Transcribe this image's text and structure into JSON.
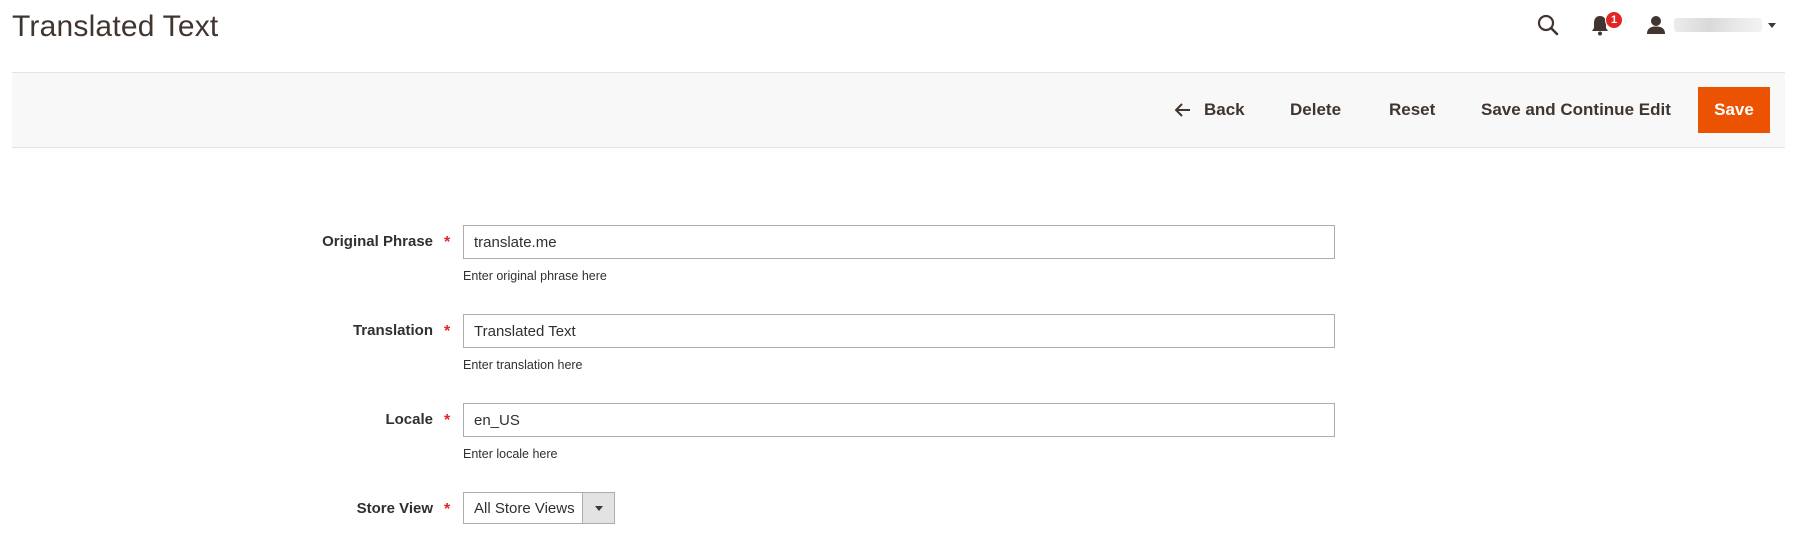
{
  "page": {
    "title": "Translated Text"
  },
  "header": {
    "notifications_count": "1",
    "icons": {
      "search": "search-icon",
      "notifications": "bell-icon",
      "user": "user-icon"
    }
  },
  "toolbar": {
    "back_label": "Back",
    "delete_label": "Delete",
    "reset_label": "Reset",
    "save_continue_label": "Save and Continue Edit",
    "save_label": "Save"
  },
  "form": {
    "original_phrase": {
      "label": "Original Phrase",
      "required": "*",
      "value": "translate.me",
      "note": "Enter original phrase here"
    },
    "translation": {
      "label": "Translation",
      "required": "*",
      "value": "Translated Text",
      "note": "Enter translation here"
    },
    "locale": {
      "label": "Locale",
      "required": "*",
      "value": "en_US",
      "note": "Enter locale here"
    },
    "store_view": {
      "label": "Store View",
      "required": "*",
      "selected": "All Store Views"
    }
  },
  "colors": {
    "accent": "#eb5202",
    "badge": "#e22626",
    "required": "#e22626",
    "text": "#41362f"
  }
}
